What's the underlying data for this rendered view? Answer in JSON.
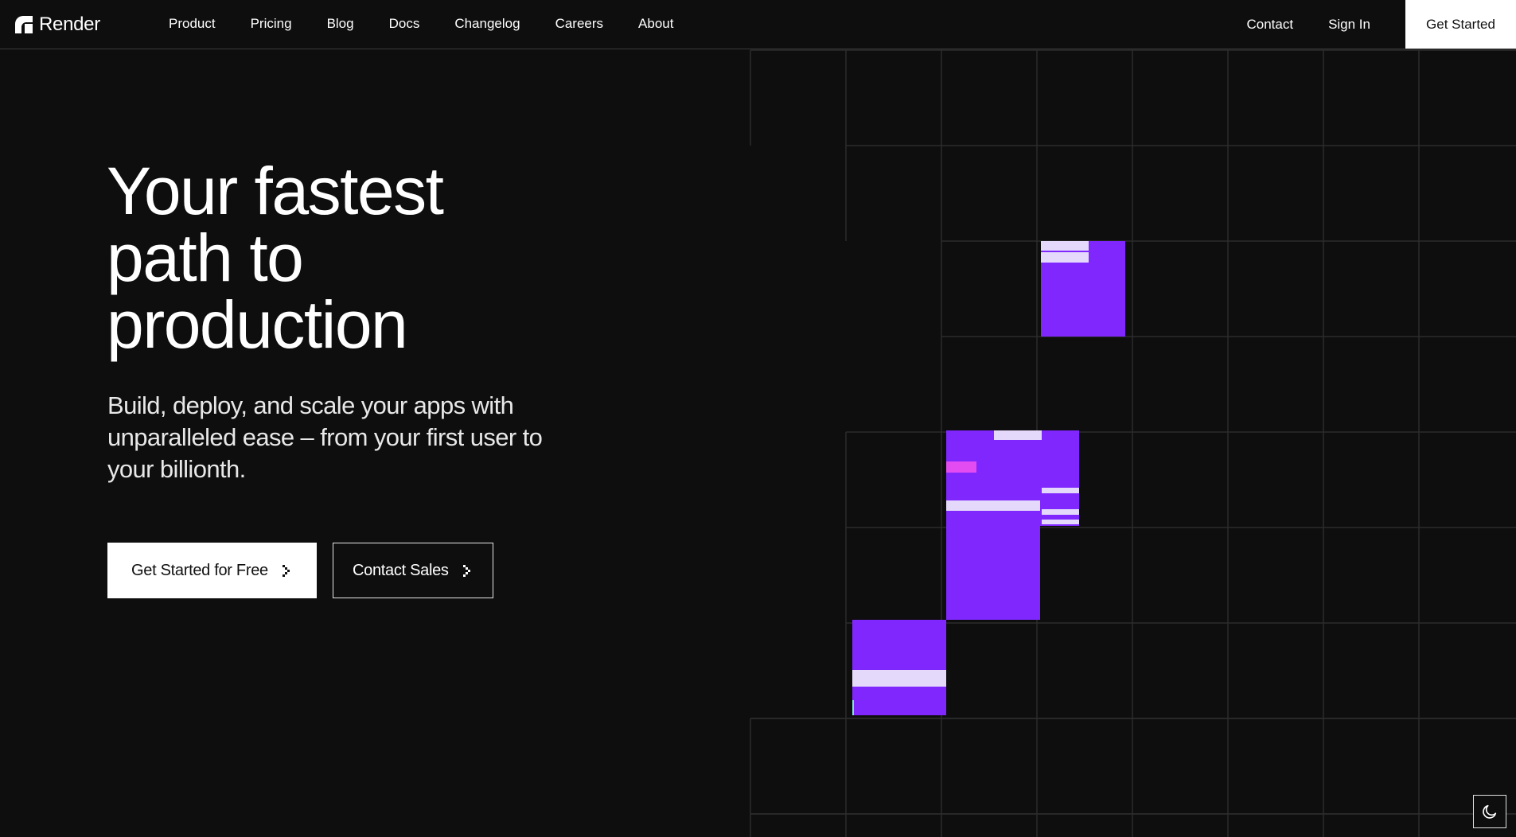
{
  "brand": {
    "name": "Render",
    "logo_icon": "render-logo-icon"
  },
  "nav": {
    "links": [
      "Product",
      "Pricing",
      "Blog",
      "Docs",
      "Changelog",
      "Careers",
      "About"
    ],
    "right_links": [
      "Contact",
      "Sign In"
    ],
    "cta": "Get Started"
  },
  "hero": {
    "headline_lines": [
      "Your fastest",
      "path to",
      "production"
    ],
    "subhead": "Build, deploy, and scale your apps with unparalleled ease – from your first user to your billionth.",
    "primary_button": "Get Started for Free",
    "secondary_button": "Contact Sales",
    "button_icon": "chevron-right-icon"
  },
  "theme_toggle": {
    "icon": "moon-icon"
  },
  "colors": {
    "background": "#0e0e0e",
    "accent": "#7f27fd",
    "accent_light": "#e4d9fb",
    "accent_pink": "#e34cf0",
    "grid_line": "#2c2c2c"
  }
}
